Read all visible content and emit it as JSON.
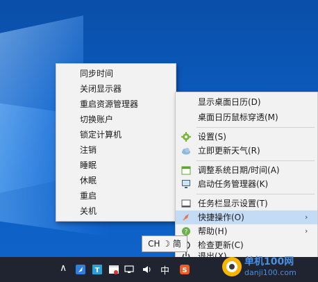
{
  "left_menu": {
    "items": [
      "同步时间",
      "关闭显示器",
      "重启资源管理器",
      "切换账户",
      "锁定计算机",
      "注销",
      "睡眠",
      "休眠",
      "重启",
      "关机"
    ]
  },
  "right_menu": {
    "items": [
      {
        "label": "显示桌面日历(D)",
        "icon": "none"
      },
      {
        "label": "桌面日历鼠标穿透(M)",
        "icon": "none"
      },
      {
        "label": "设置(S)",
        "icon": "gear-icon"
      },
      {
        "label": "立即更新天气(R)",
        "icon": "cloud-icon"
      },
      {
        "label": "调整系统日期/时间(A)",
        "icon": "calendar-icon"
      },
      {
        "label": "启动任务管理器(K)",
        "icon": "monitor-icon"
      },
      {
        "label": "任务栏显示设置(T)",
        "icon": "taskbar-icon"
      },
      {
        "label": "快捷操作(O)",
        "icon": "rocket-icon",
        "highlighted": true,
        "submenu_arrow": "›"
      },
      {
        "label": "帮助(H)",
        "icon": "help-icon",
        "submenu_arrow": "›"
      },
      {
        "label": "检查更新(C)",
        "icon": "update-icon"
      },
      {
        "label": "退出(X)",
        "icon": "power-icon"
      }
    ]
  },
  "tooltip": {
    "text": "CH ☽ 简"
  },
  "taskbar": {
    "chevron": "∧",
    "ime_label": "中",
    "volume_icon": "volume-icon"
  },
  "watermark": {
    "line1": "单机100网",
    "line2": "danji100.com"
  },
  "colors": {
    "highlight": "#c4dbf5",
    "taskbar": "#1f2430",
    "desktop": "#0b5cc0"
  }
}
